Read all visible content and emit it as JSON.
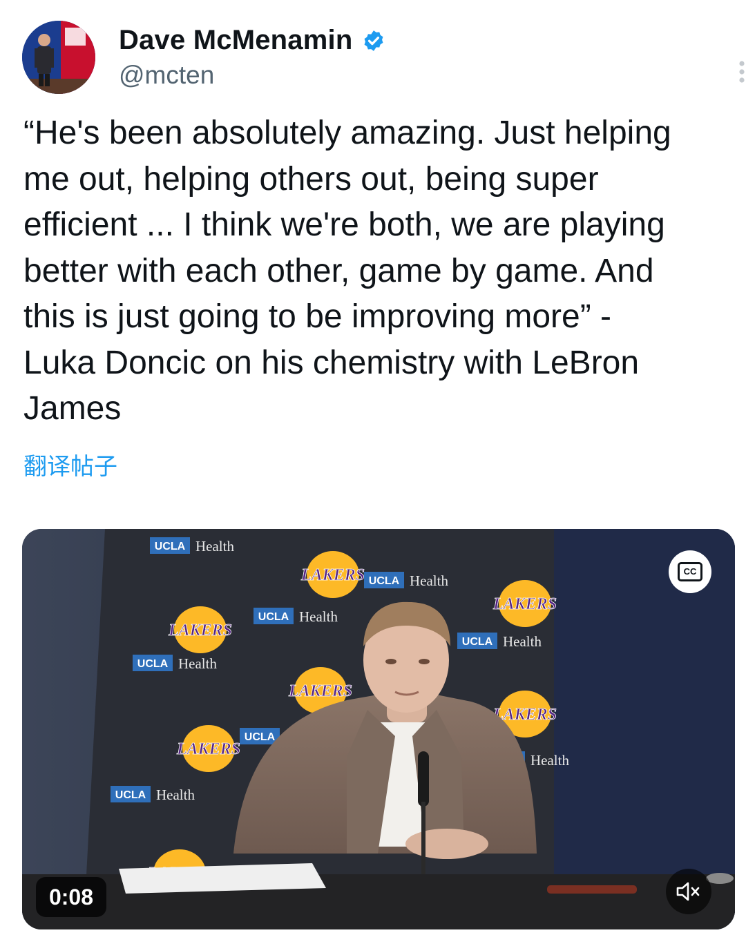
{
  "author": {
    "display_name": "Dave McMenamin",
    "handle": "@mcten",
    "verified": true
  },
  "tweet": {
    "text": "“He's been absolutely amazing. Just helping\nme out, helping others out, being super\nefficient ... I think we're both, we are playing\nbetter with each other, game by game. And\nthis is just going to be improving more” -\nLuka Doncic on his chemistry with LeBron\nJames",
    "translate_label": "翻译帖子"
  },
  "video": {
    "timestamp": "0:08",
    "cc_label": "CC",
    "backdrop_sponsor": "UCLA",
    "backdrop_sponsor_suffix": "Health",
    "backdrop_team": "LAKERS"
  },
  "colors": {
    "link": "#1d9bf0",
    "text": "#0f1419",
    "secondary": "#536471",
    "lakers_gold": "#fdb927",
    "lakers_purple": "#552583"
  },
  "icons": [
    "verified-badge-icon",
    "more-options-icon",
    "closed-captions-icon",
    "mute-icon"
  ]
}
